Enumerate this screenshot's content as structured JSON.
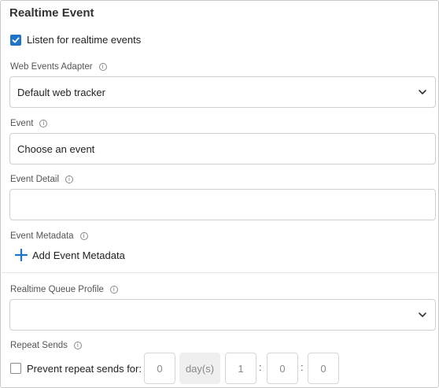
{
  "section": {
    "title": "Realtime Event"
  },
  "listen": {
    "label": "Listen for realtime events",
    "checked": true
  },
  "adapter": {
    "label": "Web Events Adapter",
    "value": "Default web tracker"
  },
  "event": {
    "label": "Event",
    "placeholder": "Choose an event"
  },
  "event_detail": {
    "label": "Event Detail",
    "value": ""
  },
  "event_metadata": {
    "label": "Event Metadata",
    "add_label": "Add Event Metadata"
  },
  "queue_profile": {
    "label": "Realtime Queue Profile",
    "value": ""
  },
  "repeat": {
    "label": "Repeat Sends",
    "checkbox_label": "Prevent repeat sends for:",
    "checked": false,
    "days": "0",
    "days_unit": "day(s)",
    "hours": "1",
    "minutes": "0",
    "seconds": "0",
    "separator": ":"
  },
  "icons": {
    "info": "info-icon",
    "chevron": "chevron-down-icon",
    "plus": "plus-icon",
    "check": "checkmark-icon"
  },
  "colors": {
    "accent": "#1f73c8",
    "border": "#cfcfcf",
    "text": "#222222"
  }
}
